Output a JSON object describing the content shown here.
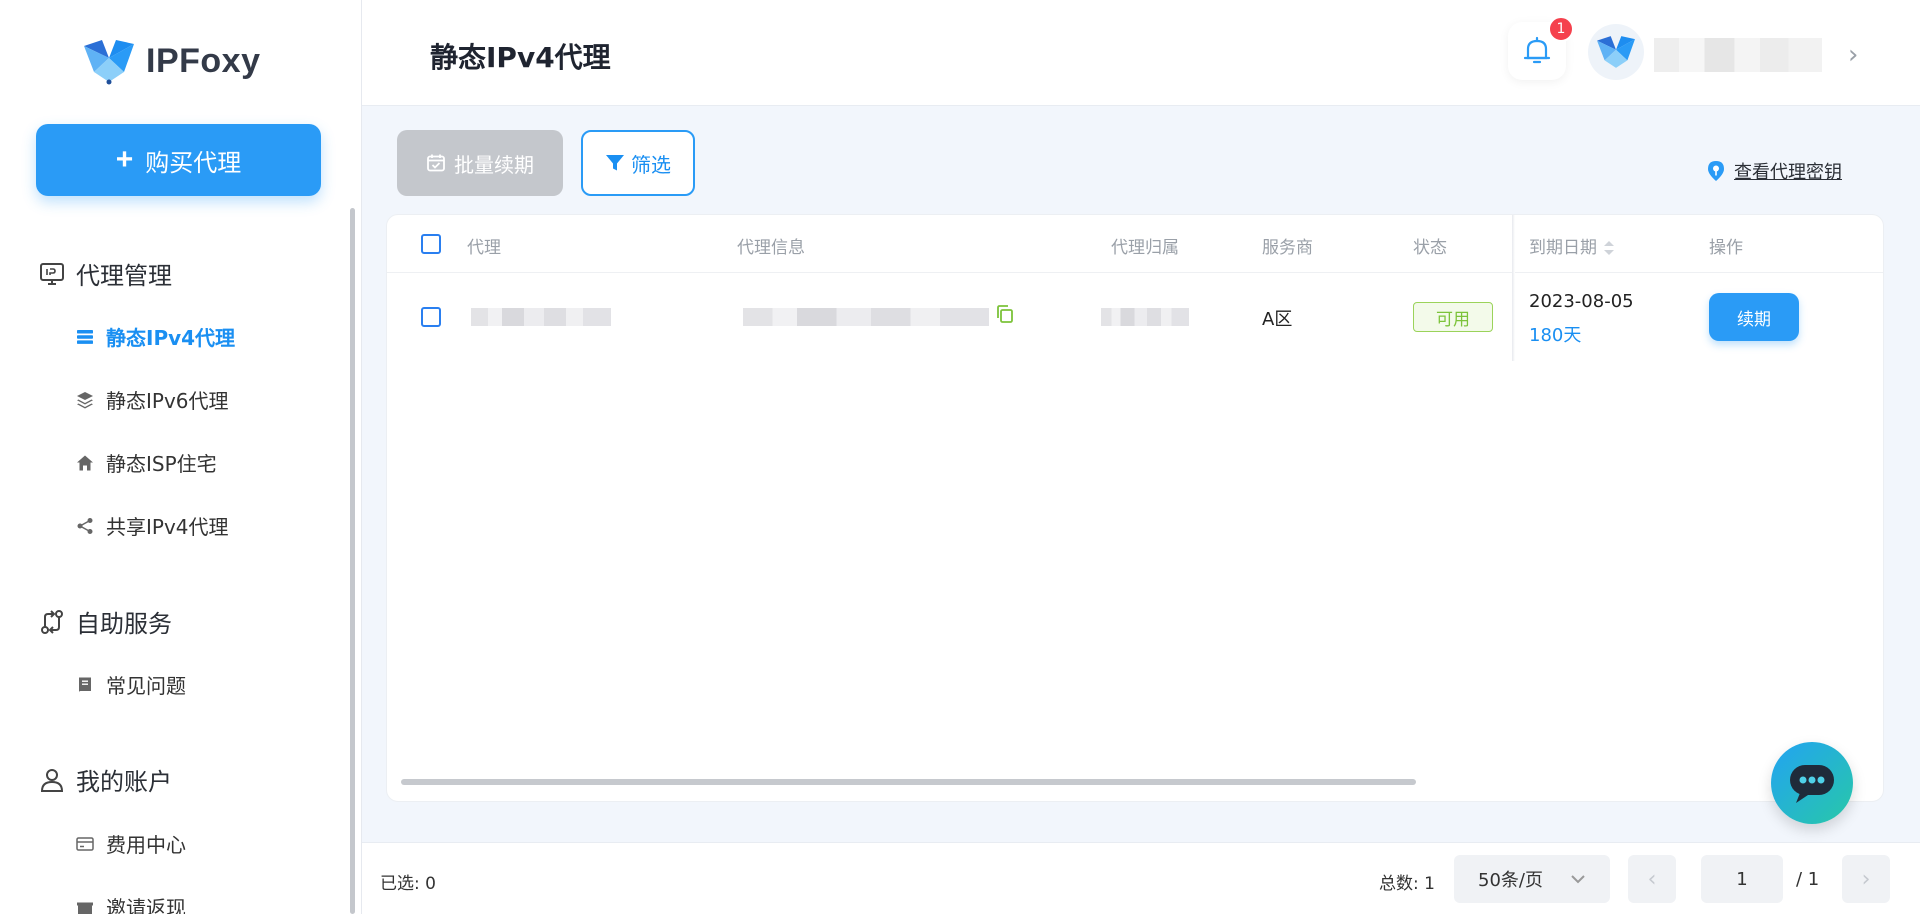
{
  "brand": {
    "name": "IPFoxy"
  },
  "sidebar": {
    "buy_button": "购买代理",
    "sections": [
      {
        "label": "代理管理",
        "items": [
          "静态IPv4代理",
          "静态IPv6代理",
          "静态ISP住宅",
          "共享IPv4代理"
        ]
      },
      {
        "label": "自助服务",
        "items": [
          "常见问题"
        ]
      },
      {
        "label": "我的账户",
        "items": [
          "费用中心",
          "邀请返现"
        ]
      }
    ],
    "active_item": "静态IPv4代理"
  },
  "header": {
    "title": "静态IPv4代理",
    "notification_count": "1"
  },
  "toolbar": {
    "batch_renew": "批量续期",
    "filter": "筛选",
    "view_key": "查看代理密钥"
  },
  "table": {
    "columns": [
      "代理",
      "代理信息",
      "代理归属",
      "服务商",
      "状态",
      "到期日期",
      "操作"
    ],
    "rows": [
      {
        "provider": "A区",
        "status": "可用",
        "expiry_date": "2023-08-05",
        "days_left": "180天",
        "action": "续期"
      }
    ]
  },
  "footer": {
    "selected": "已选: 0",
    "total": "总数: 1",
    "page_size": "50条/页",
    "current_page": "1",
    "total_pages": "/ 1"
  },
  "colors": {
    "primary": "#2a9bf6",
    "status_ok": "#7cc33a",
    "badge": "#f5414d"
  }
}
